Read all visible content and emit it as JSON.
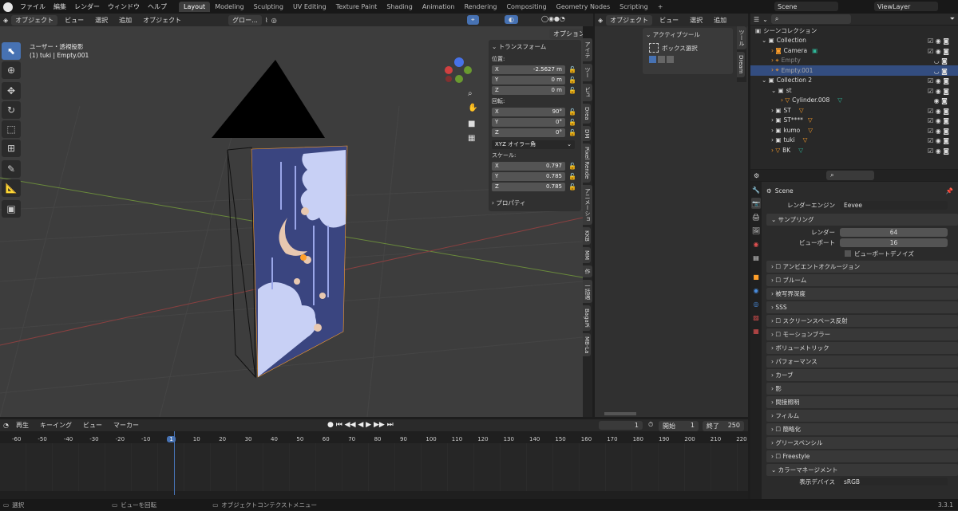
{
  "topbar": {
    "menus": [
      "ファイル",
      "編集",
      "レンダー",
      "ウィンドウ",
      "ヘルプ"
    ],
    "workspaces": [
      "Layout",
      "Modeling",
      "Sculpting",
      "UV Editing",
      "Texture Paint",
      "Shading",
      "Animation",
      "Rendering",
      "Compositing",
      "Geometry Nodes",
      "Scripting"
    ],
    "active_workspace": "Layout",
    "scene": "Scene",
    "view_layer": "ViewLayer"
  },
  "viewport_header": {
    "mode": "オブジェクト",
    "menus": [
      "ビュー",
      "選択",
      "追加",
      "オブジェクト"
    ],
    "transform_orientation": "グロー...",
    "options": "オプション"
  },
  "viewport": {
    "view_name": "ユーザー・透視投影",
    "object_info": "(1) tuki | Empty.001"
  },
  "npanel": {
    "transform_title": "トランスフォーム",
    "location_label": "位置:",
    "location": [
      {
        "axis": "X",
        "value": "-2.5627 m"
      },
      {
        "axis": "Y",
        "value": "0 m"
      },
      {
        "axis": "Z",
        "value": "0 m"
      }
    ],
    "rotation_label": "回転:",
    "rotation": [
      {
        "axis": "X",
        "value": "90°"
      },
      {
        "axis": "Y",
        "value": "0°"
      },
      {
        "axis": "Z",
        "value": "0°"
      }
    ],
    "rotation_mode": "XYZ オイラー角",
    "scale_label": "スケール:",
    "scale": [
      {
        "axis": "X",
        "value": "0.797"
      },
      {
        "axis": "Y",
        "value": "0.785"
      },
      {
        "axis": "Z",
        "value": "0.785"
      }
    ],
    "properties_title": "プロパティ"
  },
  "side_tabs": [
    "アイテ",
    "ツー",
    "ビュ",
    "Drea",
    "DM",
    "Pixel Rende",
    "アニメーショ",
    "KKB",
    "MM",
    "作",
    "一括適",
    "BagaPi",
    "MB-La"
  ],
  "mid_header": {
    "mode": "オブジェクト",
    "menus": [
      "ビュー",
      "選択",
      "追加"
    ]
  },
  "active_tool": {
    "title": "アクティブツール",
    "tool": "ボックス選択"
  },
  "mid_tabs": [
    "ツール",
    "Dream"
  ],
  "outliner": {
    "title": "シーンコレクション",
    "rows": [
      {
        "label": "Collection",
        "indent": 1
      },
      {
        "label": "Camera",
        "indent": 2
      },
      {
        "label": "Empty",
        "indent": 2
      },
      {
        "label": "Empty.001",
        "indent": 2
      },
      {
        "label": "Collection 2",
        "indent": 1
      },
      {
        "label": "st",
        "indent": 2
      },
      {
        "label": "Cylinder.008",
        "indent": 3
      },
      {
        "label": "ST",
        "indent": 2
      },
      {
        "label": "ST****",
        "indent": 2
      },
      {
        "label": "kumo",
        "indent": 2
      },
      {
        "label": "tuki",
        "indent": 2
      },
      {
        "label": "BK",
        "indent": 2
      }
    ]
  },
  "properties": {
    "scene": "Scene",
    "render_engine_label": "レンダーエンジン",
    "render_engine": "Eevee",
    "sampling_title": "サンプリング",
    "render_label": "レンダー",
    "render_samples": "64",
    "viewport_label": "ビューポート",
    "viewport_samples": "16",
    "denoise_label": "ビューポートデノイズ",
    "sections": [
      "アンビエントオクルージョン",
      "ブルーム",
      "被写界深度",
      "SSS",
      "スクリーンスペース反射",
      "モーションブラー",
      "ボリューメトリック",
      "パフォーマンス",
      "カーブ",
      "影",
      "間接照明",
      "フィルム",
      "簡略化",
      "グリースペンシル",
      "Freestyle",
      "カラーマネージメント"
    ],
    "display_device_label": "表示デバイス",
    "display_device": "sRGB"
  },
  "timeline": {
    "menus": [
      "再生",
      "キーイング",
      "ビュー",
      "マーカー"
    ],
    "current_frame": "1",
    "start_label": "開始",
    "start": "1",
    "end_label": "終了",
    "end": "250",
    "ticks": [
      "-60",
      "-50",
      "-40",
      "-30",
      "-20",
      "-10",
      "1",
      "10",
      "20",
      "30",
      "40",
      "50",
      "60",
      "70",
      "80",
      "90",
      "100",
      "110",
      "120",
      "130",
      "140",
      "150",
      "160",
      "170",
      "180",
      "190",
      "200",
      "210",
      "220"
    ]
  },
  "status": {
    "select": "選択",
    "rotate": "ビューを回転",
    "context": "オブジェクトコンテクストメニュー",
    "version": "3.3.1"
  },
  "colors": {
    "accent": "#4772b3",
    "banner_bg": "#3a4580",
    "cloud": "#c8d0f5"
  }
}
